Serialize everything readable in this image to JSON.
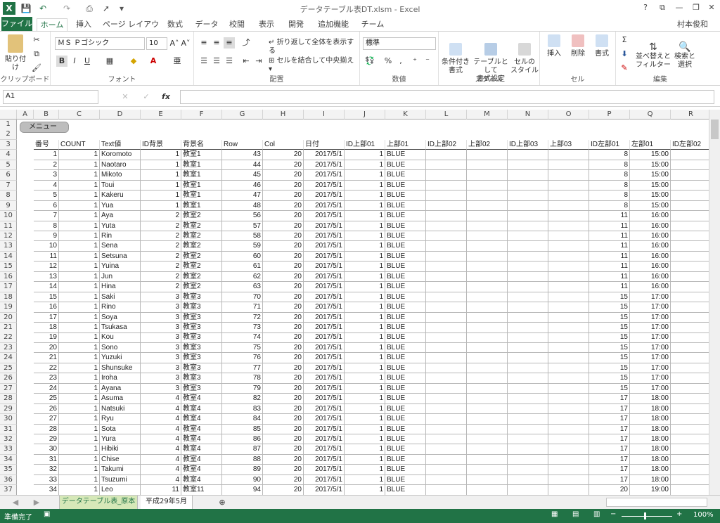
{
  "window": {
    "title": "データテーブル表DT.xlsm - Excel",
    "user": "村本俊和",
    "help": "?",
    "min": "—",
    "restore": "❐",
    "close": "✕"
  },
  "tabs": [
    "ファイル",
    "ホーム",
    "挿入",
    "ページ レイアウト",
    "数式",
    "データ",
    "校閲",
    "表示",
    "開発",
    "追加機能",
    "チーム"
  ],
  "ribbon": {
    "clipboard": {
      "label": "クリップボード",
      "paste": "貼り付け"
    },
    "font": {
      "label": "フォント",
      "name": "ＭＳ Ｐゴシック",
      "size": "10",
      "bold": "B",
      "italic": "I",
      "underline": "U"
    },
    "alignment": {
      "label": "配置",
      "wrap": "折り返して全体を表示する",
      "merge": "セルを結合して中央揃え"
    },
    "number": {
      "label": "数値",
      "format": "標準",
      "percent": "%",
      "comma": ","
    },
    "styles": {
      "label": "スタイル",
      "cond": "条件付き\n書式",
      "table": "テーブルとして\n書式設定",
      "cell": "セルの\nスタイル"
    },
    "cells": {
      "label": "セル",
      "insert": "挿入",
      "delete": "削除",
      "format": "書式"
    },
    "editing": {
      "label": "編集",
      "sort": "並べ替えと\nフィルター",
      "find": "検索と\n選択"
    }
  },
  "formula": {
    "namebox": "A1",
    "fx": "fx",
    "value": ""
  },
  "columns": [
    "A",
    "B",
    "C",
    "D",
    "E",
    "F",
    "G",
    "H",
    "I",
    "J",
    "K",
    "L",
    "M",
    "N",
    "O",
    "P",
    "Q",
    "R"
  ],
  "menu_button": "メニュー",
  "headers": [
    "番号",
    "COUNT",
    "Text値",
    "ID背景",
    "背景名",
    "Row",
    "Col",
    "日付",
    "ID上部01",
    "上部01",
    "ID上部02",
    "上部02",
    "ID上部03",
    "上部03",
    "ID左部01",
    "左部01",
    "ID左部02"
  ],
  "rows": [
    [
      "1",
      "1",
      "Koromoto",
      "1",
      "教室1",
      "43",
      "20",
      "2017/5/1",
      "1",
      "BLUE",
      "8",
      "15:00"
    ],
    [
      "2",
      "1",
      "Naotaro",
      "1",
      "教室1",
      "44",
      "20",
      "2017/5/1",
      "1",
      "BLUE",
      "8",
      "15:00"
    ],
    [
      "3",
      "1",
      "Mikoto",
      "1",
      "教室1",
      "45",
      "20",
      "2017/5/1",
      "1",
      "BLUE",
      "8",
      "15:00"
    ],
    [
      "4",
      "1",
      "Toui",
      "1",
      "教室1",
      "46",
      "20",
      "2017/5/1",
      "1",
      "BLUE",
      "8",
      "15:00"
    ],
    [
      "5",
      "1",
      "Kakeru",
      "1",
      "教室1",
      "47",
      "20",
      "2017/5/1",
      "1",
      "BLUE",
      "8",
      "15:00"
    ],
    [
      "6",
      "1",
      "Yua",
      "1",
      "教室1",
      "48",
      "20",
      "2017/5/1",
      "1",
      "BLUE",
      "8",
      "15:00"
    ],
    [
      "7",
      "1",
      "Aya",
      "2",
      "教室2",
      "56",
      "20",
      "2017/5/1",
      "1",
      "BLUE",
      "11",
      "16:00"
    ],
    [
      "8",
      "1",
      "Yuta",
      "2",
      "教室2",
      "57",
      "20",
      "2017/5/1",
      "1",
      "BLUE",
      "11",
      "16:00"
    ],
    [
      "9",
      "1",
      "Rin",
      "2",
      "教室2",
      "58",
      "20",
      "2017/5/1",
      "1",
      "BLUE",
      "11",
      "16:00"
    ],
    [
      "10",
      "1",
      "Sena",
      "2",
      "教室2",
      "59",
      "20",
      "2017/5/1",
      "1",
      "BLUE",
      "11",
      "16:00"
    ],
    [
      "11",
      "1",
      "Setsuna",
      "2",
      "教室2",
      "60",
      "20",
      "2017/5/1",
      "1",
      "BLUE",
      "11",
      "16:00"
    ],
    [
      "12",
      "1",
      "Yuina",
      "2",
      "教室2",
      "61",
      "20",
      "2017/5/1",
      "1",
      "BLUE",
      "11",
      "16:00"
    ],
    [
      "13",
      "1",
      "Jun",
      "2",
      "教室2",
      "62",
      "20",
      "2017/5/1",
      "1",
      "BLUE",
      "11",
      "16:00"
    ],
    [
      "14",
      "1",
      "Hina",
      "2",
      "教室2",
      "63",
      "20",
      "2017/5/1",
      "1",
      "BLUE",
      "11",
      "16:00"
    ],
    [
      "15",
      "1",
      "Saki",
      "3",
      "教室3",
      "70",
      "20",
      "2017/5/1",
      "1",
      "BLUE",
      "15",
      "17:00"
    ],
    [
      "16",
      "1",
      "Rino",
      "3",
      "教室3",
      "71",
      "20",
      "2017/5/1",
      "1",
      "BLUE",
      "15",
      "17:00"
    ],
    [
      "17",
      "1",
      "Soya",
      "3",
      "教室3",
      "72",
      "20",
      "2017/5/1",
      "1",
      "BLUE",
      "15",
      "17:00"
    ],
    [
      "18",
      "1",
      "Tsukasa",
      "3",
      "教室3",
      "73",
      "20",
      "2017/5/1",
      "1",
      "BLUE",
      "15",
      "17:00"
    ],
    [
      "19",
      "1",
      "Kou",
      "3",
      "教室3",
      "74",
      "20",
      "2017/5/1",
      "1",
      "BLUE",
      "15",
      "17:00"
    ],
    [
      "20",
      "1",
      "Sono",
      "3",
      "教室3",
      "75",
      "20",
      "2017/5/1",
      "1",
      "BLUE",
      "15",
      "17:00"
    ],
    [
      "21",
      "1",
      "Yuzuki",
      "3",
      "教室3",
      "76",
      "20",
      "2017/5/1",
      "1",
      "BLUE",
      "15",
      "17:00"
    ],
    [
      "22",
      "1",
      "Shunsuke",
      "3",
      "教室3",
      "77",
      "20",
      "2017/5/1",
      "1",
      "BLUE",
      "15",
      "17:00"
    ],
    [
      "23",
      "1",
      "Iroha",
      "3",
      "教室3",
      "78",
      "20",
      "2017/5/1",
      "1",
      "BLUE",
      "15",
      "17:00"
    ],
    [
      "24",
      "1",
      "Ayana",
      "3",
      "教室3",
      "79",
      "20",
      "2017/5/1",
      "1",
      "BLUE",
      "15",
      "17:00"
    ],
    [
      "25",
      "1",
      "Asuma",
      "4",
      "教室4",
      "82",
      "20",
      "2017/5/1",
      "1",
      "BLUE",
      "17",
      "18:00"
    ],
    [
      "26",
      "1",
      "Natsuki",
      "4",
      "教室4",
      "83",
      "20",
      "2017/5/1",
      "1",
      "BLUE",
      "17",
      "18:00"
    ],
    [
      "27",
      "1",
      "Ryu",
      "4",
      "教室4",
      "84",
      "20",
      "2017/5/1",
      "1",
      "BLUE",
      "17",
      "18:00"
    ],
    [
      "28",
      "1",
      "Sota",
      "4",
      "教室4",
      "85",
      "20",
      "2017/5/1",
      "1",
      "BLUE",
      "17",
      "18:00"
    ],
    [
      "29",
      "1",
      "Yura",
      "4",
      "教室4",
      "86",
      "20",
      "2017/5/1",
      "1",
      "BLUE",
      "17",
      "18:00"
    ],
    [
      "30",
      "1",
      "Hibiki",
      "4",
      "教室4",
      "87",
      "20",
      "2017/5/1",
      "1",
      "BLUE",
      "17",
      "18:00"
    ],
    [
      "31",
      "1",
      "Chise",
      "4",
      "教室4",
      "88",
      "20",
      "2017/5/1",
      "1",
      "BLUE",
      "17",
      "18:00"
    ],
    [
      "32",
      "1",
      "Takumi",
      "4",
      "教室4",
      "89",
      "20",
      "2017/5/1",
      "1",
      "BLUE",
      "17",
      "18:00"
    ],
    [
      "33",
      "1",
      "Tsuzumi",
      "4",
      "教室4",
      "90",
      "20",
      "2017/5/1",
      "1",
      "BLUE",
      "17",
      "18:00"
    ],
    [
      "34",
      "1",
      "Leo",
      "11",
      "教室11",
      "94",
      "20",
      "2017/5/1",
      "1",
      "BLUE",
      "20",
      "19:00"
    ]
  ],
  "sheets": [
    "データテーブル表_原本",
    "平成29年5月"
  ],
  "status": {
    "ready": "準備完了",
    "zoom": "100%"
  },
  "colors": {
    "excel_green": "#217346",
    "sheet_tab": "#d6e8b8"
  }
}
